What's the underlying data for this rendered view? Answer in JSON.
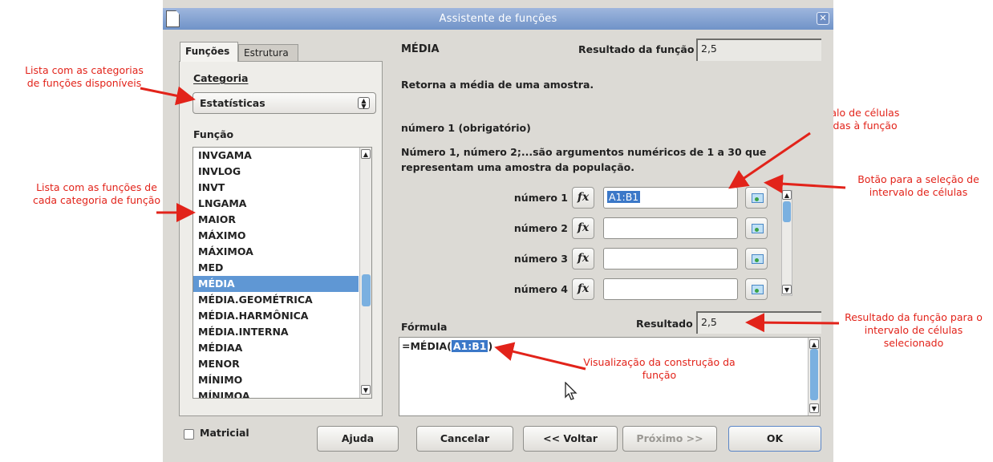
{
  "window": {
    "title": "Assistente de funções",
    "close_glyph": "✕"
  },
  "tabs": [
    {
      "label": "Funções",
      "active": true
    },
    {
      "label": "Estrutura",
      "active": false
    }
  ],
  "category": {
    "label": "Categoria",
    "value": "Estatísticas"
  },
  "function_list": {
    "label": "Função",
    "items": [
      "INVGAMA",
      "INVLOG",
      "INVT",
      "LNGAMA",
      "MAIOR",
      "MÁXIMO",
      "MÁXIMOA",
      "MED",
      "MÉDIA",
      "MÉDIA.GEOMÉTRICA",
      "MÉDIA.HARMÔNICA",
      "MÉDIA.INTERNA",
      "MÉDIAA",
      "MENOR",
      "MÍNIMO",
      "MÍNIMOA"
    ],
    "selected": "MÉDIA"
  },
  "function_info": {
    "name": "MÉDIA",
    "result_label": "Resultado da função",
    "result_value": "2,5",
    "description": "Retorna a média de uma amostra.",
    "argument_title": "número 1 (obrigatório)",
    "argument_description": "Número 1, número 2;...são argumentos numéricos de 1 a 30 que representam uma amostra da população."
  },
  "arguments": [
    {
      "label": "número 1",
      "value": "A1:B1"
    },
    {
      "label": "número 2",
      "value": ""
    },
    {
      "label": "número 3",
      "value": ""
    },
    {
      "label": "número 4",
      "value": ""
    }
  ],
  "fx_glyph": "fx",
  "formula": {
    "label": "Fórmula",
    "prefix": "=MÉDIA(",
    "range": "A1:B1",
    "suffix": ")",
    "result_label": "Resultado",
    "result_value": "2,5"
  },
  "matricial": {
    "label": "Matricial",
    "checked": false
  },
  "buttons": {
    "help": "Ajuda",
    "cancel": "Cancelar",
    "back": "<< Voltar",
    "next": "Próximo >>",
    "ok": "OK"
  },
  "annotations": {
    "categories": "Lista com as categorias de funções disponíveis",
    "functions": "Lista com as funções de cada categoria de função",
    "interval": "Intervalo de células aplicadas à função",
    "select_button": "Botão para a seleção de intervalo de células",
    "result": "Resultado da função para o intervalo de células selecionado",
    "formula_view": "Visualização da construção da função"
  },
  "colors": {
    "annotation": "#e2231a",
    "selection": "#5f97d4",
    "titlebar": "#7f9fd2"
  }
}
